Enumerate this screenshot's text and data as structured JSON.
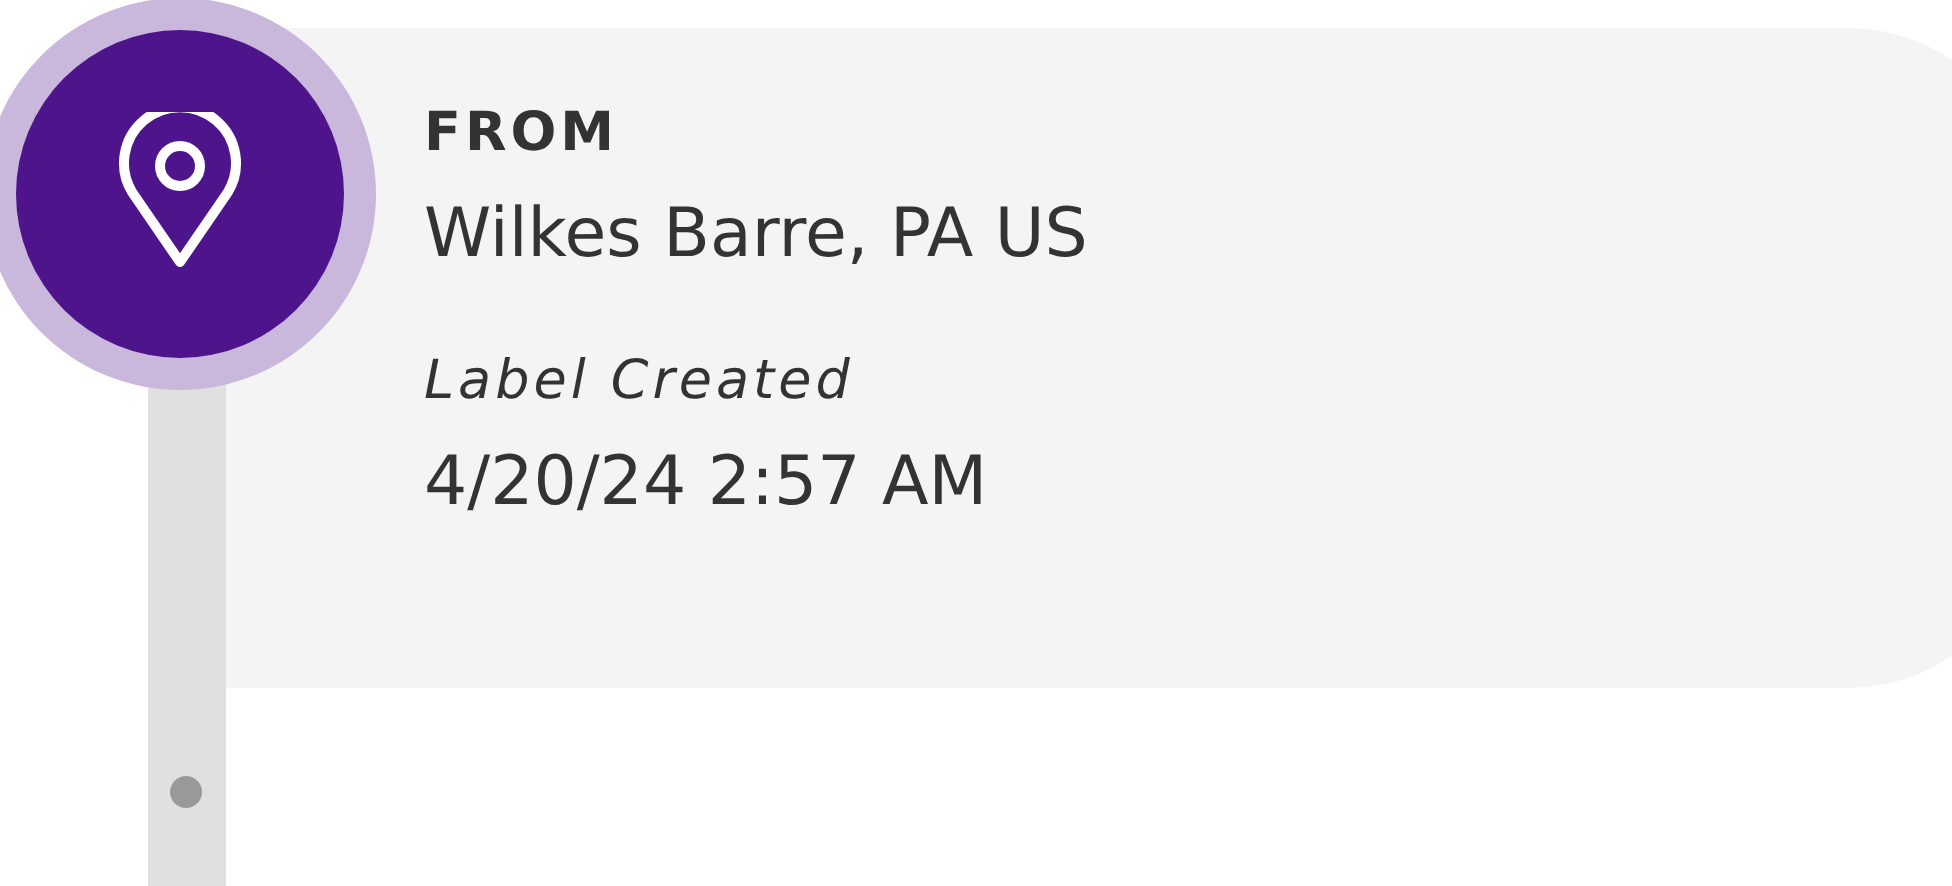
{
  "origin": {
    "label": "FROM",
    "location": "Wilkes Barre, PA US"
  },
  "event": {
    "status": "Label Created",
    "datetime": "4/20/24 2:57 AM"
  }
}
